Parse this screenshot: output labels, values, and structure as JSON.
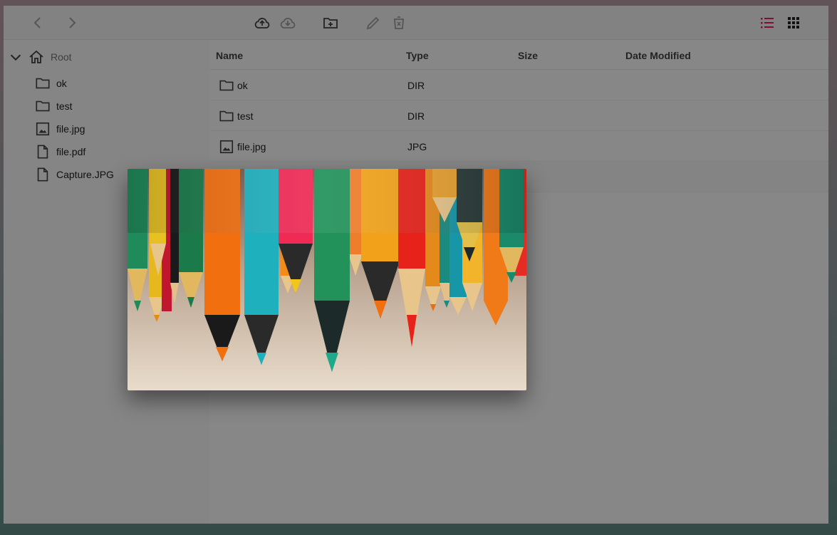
{
  "toolbar": {
    "back_icon": "chevron-left-icon",
    "forward_icon": "chevron-right-icon",
    "upload_icon": "cloud-upload-icon",
    "download_icon": "cloud-download-icon",
    "new_folder_icon": "folder-plus-icon",
    "rename_icon": "pencil-icon",
    "delete_icon": "trash-icon",
    "list_view_icon": "list-view-icon",
    "grid_view_icon": "grid-view-icon",
    "accent_color": "#e91e63"
  },
  "sidebar": {
    "root_label": "Root",
    "items": [
      {
        "label": "ok",
        "icon": "folder-icon"
      },
      {
        "label": "test",
        "icon": "folder-icon"
      },
      {
        "label": "file.jpg",
        "icon": "image-file-icon"
      },
      {
        "label": "file.pdf",
        "icon": "file-icon"
      },
      {
        "label": "Capture.JPG",
        "icon": "file-icon"
      }
    ]
  },
  "table": {
    "columns": [
      "Name",
      "Type",
      "Size",
      "Date Modified"
    ],
    "rows": [
      {
        "name": "ok",
        "type": "DIR",
        "icon": "folder-icon"
      },
      {
        "name": "test",
        "type": "DIR",
        "icon": "folder-icon"
      },
      {
        "name": "file.jpg",
        "type": "JPG",
        "icon": "image-file-icon"
      }
    ]
  },
  "preview": {
    "subject": "colored-pencils-photo"
  }
}
